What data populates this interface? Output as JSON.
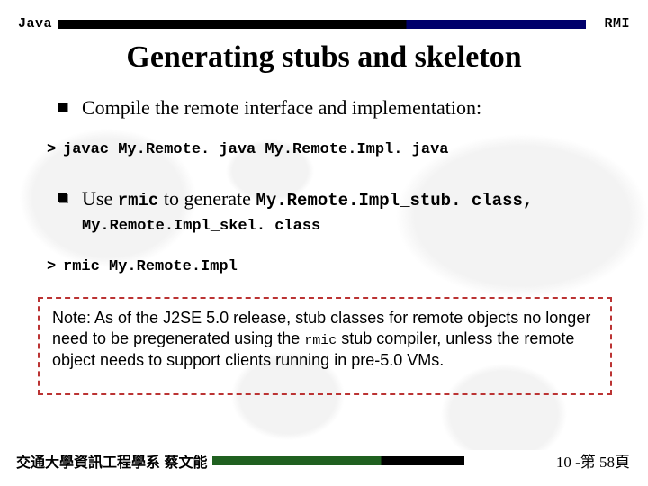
{
  "header": {
    "left": "Java",
    "right": "RMI"
  },
  "title": "Generating stubs and skeleton",
  "bullets": {
    "b1": "Compile the remote interface and implementation:",
    "b2_pre": "Use ",
    "b2_cmd": "rmic",
    "b2_mid": " to generate ",
    "b2_code1": "My.Remote.Impl_stub. class,",
    "b2_code2": "My.Remote.Impl_skel. class"
  },
  "cmds": {
    "c1": "javac My.Remote. java My.Remote.Impl. java",
    "c2": "rmic My.Remote.Impl"
  },
  "note": {
    "pre": "Note: As of the J2SE 5.0 release, stub classes for remote objects no longer need to be pregenerated using the ",
    "rmic": "rmic",
    "post": " stub compiler, unless the remote object needs to support clients running in pre-5.0 VMs."
  },
  "footer": {
    "left": "交通大學資訊工程學系 蔡文能",
    "right": "10 -第 58頁"
  }
}
